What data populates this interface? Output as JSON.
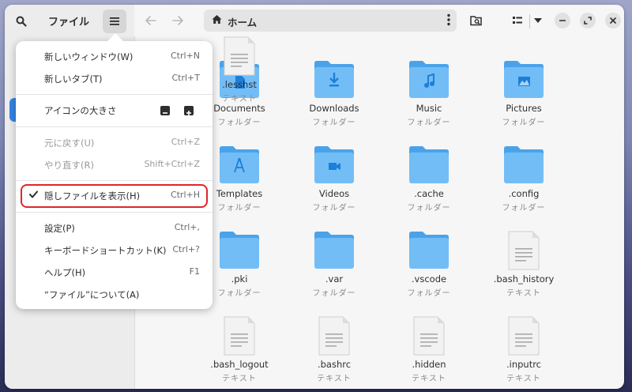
{
  "app": {
    "sidebar_title": "ファイル",
    "path_label": "ホーム"
  },
  "menu": {
    "items": [
      {
        "label": "新しいウィンドウ(W)",
        "accel": "Ctrl+N",
        "enabled": true
      },
      {
        "label": "新しいタブ(T)",
        "accel": "Ctrl+T",
        "enabled": true
      },
      {
        "label": "アイコンの大きさ",
        "accel": "",
        "enabled": true
      },
      {
        "label": "元に戻す(U)",
        "accel": "Ctrl+Z",
        "enabled": false
      },
      {
        "label": "やり直す(R)",
        "accel": "Shift+Ctrl+Z",
        "enabled": false
      },
      {
        "label": "隠しファイルを表示(H)",
        "accel": "Ctrl+H",
        "enabled": true,
        "checked": true
      },
      {
        "label": "設定(P)",
        "accel": "Ctrl+,",
        "enabled": true
      },
      {
        "label": "キーボードショートカット(K)",
        "accel": "Ctrl+?",
        "enabled": true
      },
      {
        "label": "ヘルプ(H)",
        "accel": "F1",
        "enabled": true
      },
      {
        "label": "“ファイル”について(A)",
        "accel": "",
        "enabled": true
      }
    ],
    "highlight_color": "#e0262a"
  },
  "files": [
    {
      "name": "Documents",
      "type": "フォルダー",
      "icon": "folder-documents-icon"
    },
    {
      "name": "Downloads",
      "type": "フォルダー",
      "icon": "folder-downloads-icon"
    },
    {
      "name": "Music",
      "type": "フォルダー",
      "icon": "folder-music-icon"
    },
    {
      "name": "Pictures",
      "type": "フォルダー",
      "icon": "folder-pictures-icon"
    },
    {
      "name": "Templates",
      "type": "フォルダー",
      "icon": "folder-templates-icon"
    },
    {
      "name": "Videos",
      "type": "フォルダー",
      "icon": "folder-videos-icon"
    },
    {
      "name": ".cache",
      "type": "フォルダー",
      "icon": "folder-icon"
    },
    {
      "name": ".config",
      "type": "フォルダー",
      "icon": "folder-icon"
    },
    {
      "name": ".pki",
      "type": "フォルダー",
      "icon": "folder-icon"
    },
    {
      "name": ".var",
      "type": "フォルダー",
      "icon": "folder-icon"
    },
    {
      "name": ".vscode",
      "type": "フォルダー",
      "icon": "folder-icon"
    },
    {
      "name": ".bash_history",
      "type": "テキスト",
      "icon": "text-file-icon"
    },
    {
      "name": ".bash_logout",
      "type": "テキスト",
      "icon": "text-file-icon"
    },
    {
      "name": ".bashrc",
      "type": "テキスト",
      "icon": "text-file-icon"
    },
    {
      "name": ".hidden",
      "type": "テキスト",
      "icon": "text-file-icon"
    },
    {
      "name": ".inputrc",
      "type": "テキスト",
      "icon": "text-file-icon"
    },
    {
      "name": ".lesshst",
      "type": "テキスト",
      "icon": "text-file-icon"
    }
  ],
  "colors": {
    "folder_body": "#73bdf6",
    "folder_tab": "#4aa3ea",
    "folder_glyph": "#1c7fd9",
    "accent": "#3584e4"
  }
}
